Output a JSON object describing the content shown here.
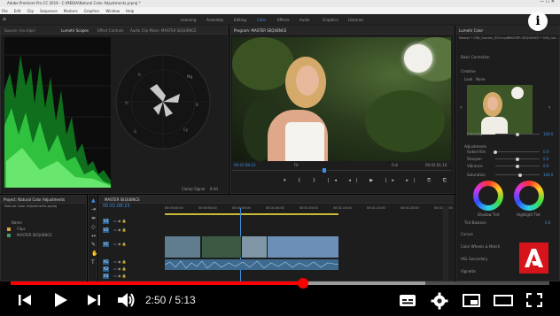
{
  "app": {
    "title": "Adobe Premiere Pro CC 2019 - C:\\MEDIA\\Natural Color Adjustments.prproj *",
    "menu": [
      "File",
      "Edit",
      "Clip",
      "Sequence",
      "Markers",
      "Graphics",
      "Window",
      "Help"
    ]
  },
  "workspaces": {
    "items": [
      "Learning",
      "Assembly",
      "Editing",
      "Color",
      "Effects",
      "Audio",
      "Graphics",
      "Libraries"
    ],
    "active": "Color"
  },
  "scopes_panel": {
    "tabs": [
      "Source: (no clips)",
      "Lumetri Scopes",
      "Effect Controls",
      "Audio Clip Mixer: MASTER SEQUENCE"
    ],
    "active_tab": "Lumetri Scopes"
  },
  "program_monitor": {
    "title": "Program: MASTER SEQUENCE",
    "timecode_in": "00:01:08:23",
    "zoom": "Fit",
    "quality": "Full",
    "timecode_out": "00:02:01:10",
    "scopes_bottom": {
      "clamp_signal": "Clamp Signal",
      "bit_mode": "8 bit"
    }
  },
  "project_panel": {
    "title": "Project: Natural Color Adjustments",
    "file": "Natural Color Adjustments.prproj",
    "items": [
      "Name",
      "Clips",
      "MASTER SEQUENCE"
    ]
  },
  "timeline": {
    "title": "MASTER SEQUENCE",
    "timecode": "00:01:08:23",
    "ruler": [
      "00:00:45:00",
      "00:00:50:00",
      "00:00:55:00",
      "00:01:00:00",
      "00:01:05:00",
      "00:01:10:00",
      "00:01:15:00",
      "00:01:20:00",
      "00:01:25:00"
    ],
    "tracks": [
      "V3",
      "V2",
      "V1",
      "A1",
      "A2",
      "A3"
    ]
  },
  "lumetri": {
    "title": "Lumetri Color",
    "master": "Master * 036_Garden_003.mp4",
    "sequence": "MASTER SEQUENCE * 036_Gar...",
    "sections": [
      "Basic Correction",
      "Creative",
      "Look",
      "None"
    ],
    "adjustments_label": "Adjustments",
    "sliders": [
      {
        "label": "Intensity",
        "value": "100.0",
        "position": 0.5
      },
      {
        "label": "Faded Film",
        "value": "0.0",
        "position": 0.0
      },
      {
        "label": "Sharpen",
        "value": "0.0",
        "position": 0.5
      },
      {
        "label": "Vibrance",
        "value": "0.0",
        "position": 0.5
      },
      {
        "label": "Saturation",
        "value": "100.0",
        "position": 0.55
      }
    ],
    "wheel_labels": [
      "Shadow Tint",
      "Highlight Tint"
    ],
    "tint_balance": {
      "label": "Tint Balance",
      "value": "0.0"
    },
    "lower_sections": [
      "Curves",
      "Color Wheels & Match",
      "HSL Secondary",
      "Vignette"
    ]
  },
  "player": {
    "current_time": "2:50",
    "duration": "5:13",
    "time_display": "2:50 / 5:13",
    "progress": 0.543,
    "buffered": 0.77,
    "colors": {
      "played": "#ff0000",
      "accent": "#3d8fe0"
    },
    "controls": [
      "previous-icon",
      "play-icon",
      "next-icon",
      "volume-icon",
      "subtitles-icon",
      "settings-icon",
      "miniplayer-icon",
      "theater-icon",
      "fullscreen-icon"
    ]
  }
}
